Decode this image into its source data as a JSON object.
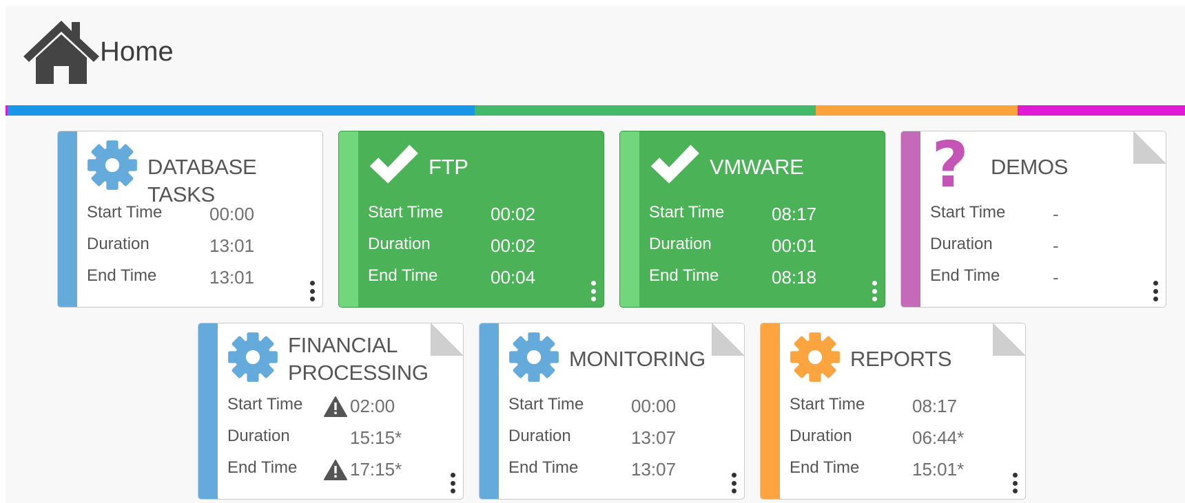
{
  "header": {
    "title": "Home",
    "icon": "home-icon"
  },
  "status_bar": {
    "segments": [
      {
        "color": "#e11ad6",
        "fraction": 0.002
      },
      {
        "color": "#1a96e8",
        "fraction": 0.396
      },
      {
        "color": "#43b96a",
        "fraction": 0.289
      },
      {
        "color": "#fba23c",
        "fraction": 0.171
      },
      {
        "color": "#e11ad6",
        "fraction": 0.142
      }
    ]
  },
  "colors": {
    "blue": "#64abdb",
    "green": "#4cb257",
    "green_stripe": "#72d67c",
    "purple": "#c46ab9",
    "orange": "#fca43f",
    "question": "#c454b5"
  },
  "labels": {
    "start": "Start Time",
    "duration": "Duration",
    "end": "End Time"
  },
  "cards": [
    {
      "title": "DATABASE TASKS",
      "icon": "gear-icon",
      "status": "default",
      "start": "00:00",
      "duration": "13:01",
      "end": "13:01"
    },
    {
      "title": "FTP",
      "icon": "checkmark-icon",
      "status": "success",
      "start": "00:02",
      "duration": "00:02",
      "end": "00:04"
    },
    {
      "title": "VMWARE",
      "icon": "checkmark-icon",
      "status": "success",
      "start": "08:17",
      "duration": "00:01",
      "end": "08:18"
    },
    {
      "title": "DEMOS",
      "icon": "question-icon",
      "status": "unknown",
      "start": "-",
      "duration": "-",
      "end": "-"
    },
    {
      "title_line1": "FINANCIAL",
      "title_line2": "PROCESSING",
      "icon": "gear-icon",
      "status": "default",
      "start": "02:00",
      "duration": "15:15*",
      "end": "17:15*",
      "start_warning": true,
      "end_warning": true
    },
    {
      "title": "MONITORING",
      "icon": "gear-icon",
      "status": "default",
      "start": "00:00",
      "duration": "13:07",
      "end": "13:07"
    },
    {
      "title": "REPORTS",
      "icon": "gear-icon",
      "status": "warning",
      "start": "08:17",
      "duration": "06:44*",
      "end": "15:01*"
    }
  ]
}
